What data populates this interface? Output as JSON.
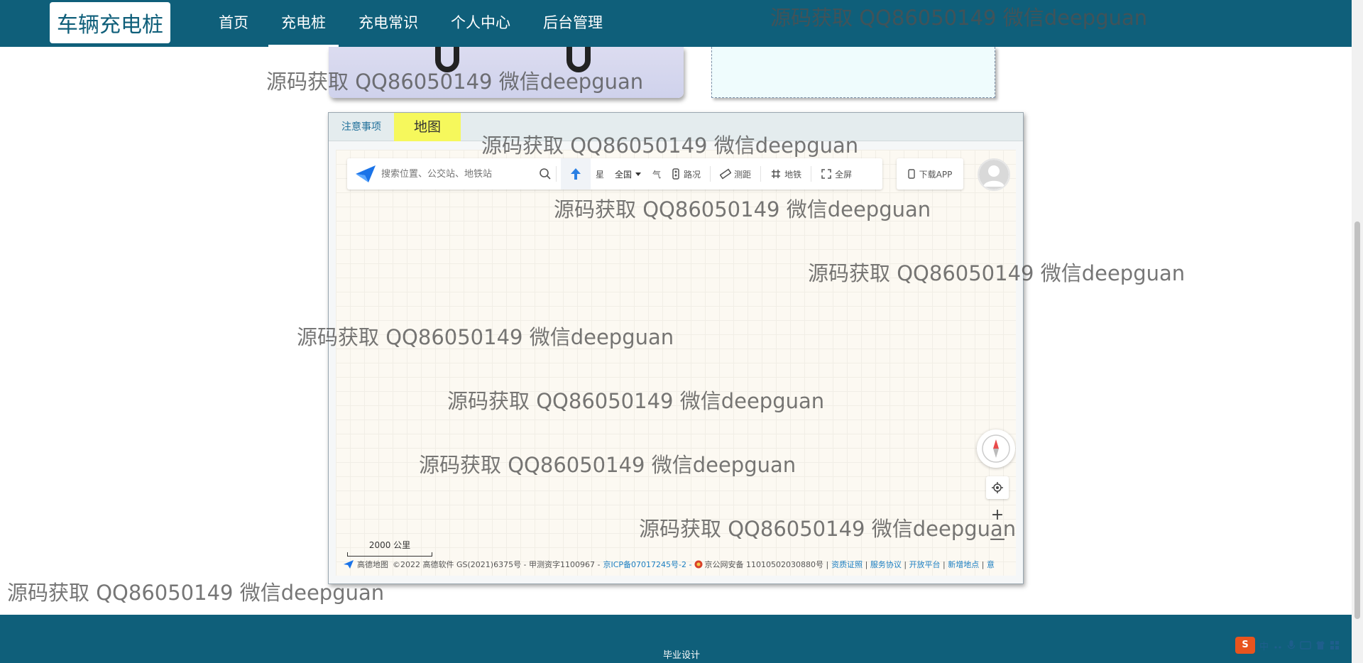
{
  "header": {
    "brand": "车辆充电桩",
    "nav": [
      "首页",
      "充电桩",
      "充电常识",
      "个人中心",
      "后台管理"
    ],
    "active_nav": "充电桩"
  },
  "map_card": {
    "tabs": [
      "注意事项",
      "地图"
    ],
    "active_tab": "地图"
  },
  "map": {
    "search_placeholder": "搜索位置、公交站、地铁站",
    "toolbar": {
      "satellite_label": "星",
      "city_label": "全国",
      "weather_label": "气",
      "traffic_label": "路况",
      "ruler_label": "测距",
      "subway_label": "地铁",
      "fullscreen_label": "全屏",
      "download_label": "下载APP"
    },
    "scale_label": "2000 公里",
    "zoom_in": "+",
    "zoom_out": "—",
    "attribution": {
      "brand": "高德地图",
      "copyright": "©2022 高德软件 GS(2021)6375号 - 甲测资字1100967 -",
      "icp": "京ICP备07017245号-2 -",
      "police": "京公网安备 11010502030880号 |",
      "links": [
        "资质证照",
        "服务协议",
        "开放平台",
        "新增地点",
        "意"
      ]
    }
  },
  "footer": {
    "text": "毕业设计"
  },
  "ime": {
    "label": "中"
  },
  "watermark_text": "源码获取 QQ86050149 微信deepguan",
  "colors": {
    "primary": "#0f5f7a",
    "active_tab": "#f6f85c",
    "link": "#1c7fc2"
  }
}
